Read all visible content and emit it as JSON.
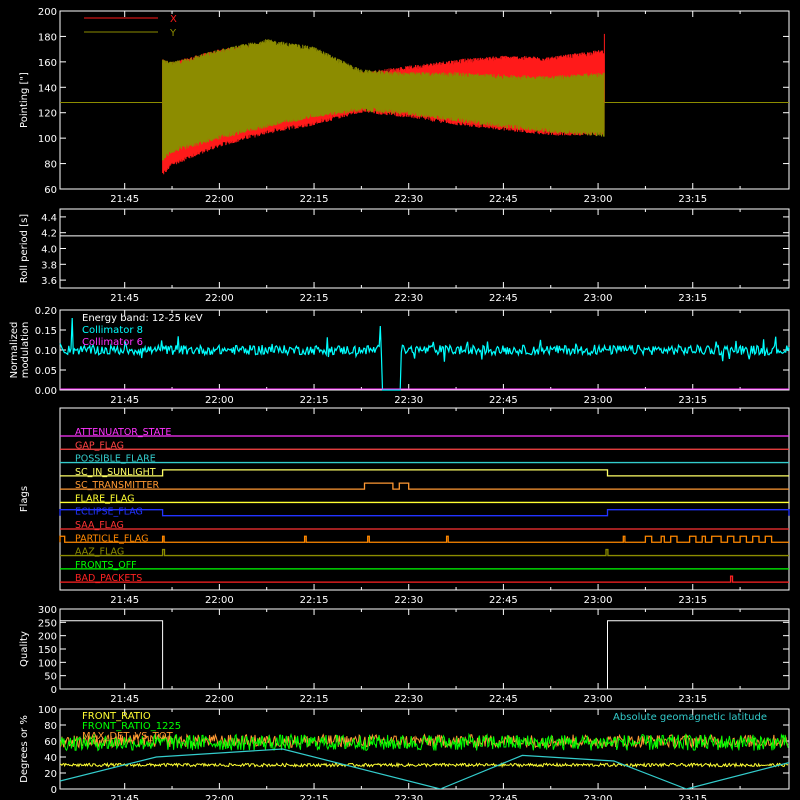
{
  "colors": {
    "background": "#000000",
    "axis": "#ffffff",
    "x_series": "#ff1a1a",
    "y_series": "#8c8c00",
    "collimator_8": "#00ffff",
    "collimator_6": "#ff33ff",
    "front_ratio": "#ffff33",
    "front_ratio_1225": "#00ff00",
    "max_det": "#ff9933",
    "geomag": "#33cccc"
  },
  "time_axis": {
    "range_minutes": [
      -20.5,
      210.5
    ],
    "tick_minutes": [
      0,
      15,
      30,
      45,
      60,
      75,
      90,
      105,
      120,
      135,
      150,
      165,
      180,
      195
    ],
    "tick_labels": [
      "21:45",
      "22:00",
      "22:15",
      "22:30",
      "22:45",
      "23:00",
      "23:15"
    ]
  },
  "chart_data": [
    {
      "id": "pointing",
      "type": "line",
      "ylabel": "Pointing [\"]",
      "ylim": [
        60,
        200
      ],
      "yticks": [
        60,
        80,
        100,
        120,
        140,
        160,
        180,
        200
      ],
      "grid": false,
      "legend": "top-left",
      "reference_line": 128,
      "series": [
        {
          "name": "X",
          "color": "#ff1a1a",
          "x_minutes": [
            12,
            15,
            30,
            45,
            60,
            75,
            90,
            105,
            120,
            135,
            152
          ],
          "low": [
            72,
            80,
            95,
            105,
            112,
            122,
            118,
            112,
            108,
            104,
            104
          ],
          "high": [
            160,
            158,
            168,
            173,
            162,
            150,
            155,
            160,
            163,
            162,
            168
          ]
        },
        {
          "name": "Y",
          "color": "#8c8c00",
          "x_minutes": [
            12,
            15,
            30,
            45,
            60,
            75,
            90,
            105,
            120,
            135,
            152
          ],
          "low": [
            84,
            90,
            101,
            110,
            118,
            123,
            120,
            115,
            110,
            106,
            103
          ],
          "high": [
            160,
            158,
            168,
            176,
            170,
            152,
            150,
            150,
            148,
            147,
            150
          ]
        }
      ]
    },
    {
      "id": "roll",
      "type": "line",
      "ylabel": "Roll period [s]",
      "ylim": [
        3.5,
        4.5
      ],
      "yticks": [
        3.6,
        3.8,
        4.0,
        4.2,
        4.4
      ],
      "tick_labels": [
        "3.6",
        "3.8",
        "4.0",
        "4.2",
        "4.4"
      ],
      "series": [
        {
          "name": "",
          "x_minutes": [
            -20.5,
            210.5
          ],
          "values": [
            4.16,
            4.16
          ]
        }
      ]
    },
    {
      "id": "modulation",
      "type": "line",
      "ylabel": "Normalized modulation",
      "ylim": [
        0,
        0.2
      ],
      "yticks": [
        0,
        0.05,
        0.1,
        0.15,
        0.2
      ],
      "tick_labels": [
        "0.00",
        "0.05",
        "0.10",
        "0.15",
        "0.20"
      ],
      "annotation": "Energy band: 12-25 keV",
      "series": [
        {
          "name": "Collimator 8",
          "baseline": 0.1,
          "scatter": 0.012,
          "gap_minutes": [
            81.5,
            87.5
          ],
          "spikes": [
            {
              "x": -16.5,
              "y": 0.18
            },
            {
              "x": 81,
              "y": 0.16
            }
          ]
        },
        {
          "name": "Collimator 6",
          "values_const": 0.0
        }
      ]
    },
    {
      "id": "flags",
      "type": "table",
      "ylabel": "Flags",
      "rows": [
        {
          "label": "ATTENUATOR_STATE",
          "color": "#ff33ff",
          "segments": []
        },
        {
          "label": "GAP_FLAG",
          "color": "#ff4444",
          "segments": []
        },
        {
          "label": "POSSIBLE_FLARE",
          "color": "#33cccc",
          "segments": []
        },
        {
          "label": "SC_IN_SUNLIGHT",
          "color": "#ffff66",
          "segments": [
            [
              12,
              153
            ]
          ]
        },
        {
          "label": "SC_TRANSMITTER",
          "color": "#ff9933",
          "segments": [
            [
              76,
              85
            ],
            [
              87,
              90
            ]
          ]
        },
        {
          "label": "FLARE_FLAG",
          "color": "#ffff33",
          "segments": []
        },
        {
          "label": "ECLIPSE_FLAG",
          "color": "#2233ff",
          "segments": [
            [
              -20.5,
              12
            ],
            [
              153,
              210.5
            ]
          ],
          "inverted": true
        },
        {
          "label": "SAA_FLAG",
          "color": "#ff3333",
          "segments": []
        },
        {
          "label": "PARTICLE_FLAG",
          "color": "#ff8800",
          "segments": [
            [
              -20.5,
              -19
            ],
            [
              12,
              12.5
            ],
            [
              57,
              57.5
            ],
            [
              77,
              77.5
            ],
            [
              102,
              102.5
            ],
            [
              158,
              158.5
            ],
            [
              165,
              167
            ],
            [
              170,
              171
            ],
            [
              173,
              175
            ],
            [
              179,
              181
            ],
            [
              183,
              184
            ],
            [
              186,
              189
            ],
            [
              191,
              193
            ],
            [
              195,
              197
            ],
            [
              199,
              201
            ],
            [
              203,
              205
            ]
          ]
        },
        {
          "label": "AAZ_FLAG",
          "color": "#8c8c00",
          "segments": [
            [
              12,
              12.6
            ],
            [
              152.5,
              153.1
            ]
          ]
        },
        {
          "label": "FRONTS_OFF",
          "color": "#00ff00",
          "segments": []
        },
        {
          "label": "BAD_PACKETS",
          "color": "#ff2222",
          "segments": [
            [
              192,
              192.6
            ]
          ]
        }
      ]
    },
    {
      "id": "quality",
      "type": "line",
      "ylabel": "Quality",
      "ylim": [
        0,
        300
      ],
      "yticks": [
        0,
        50,
        100,
        150,
        200,
        250,
        300
      ],
      "series": [
        {
          "name": "",
          "x_minutes": [
            -20.5,
            12,
            12,
            153,
            153,
            210.5
          ],
          "values": [
            256,
            256,
            0,
            0,
            256,
            256
          ]
        }
      ]
    },
    {
      "id": "ratios",
      "type": "line",
      "ylabel": "Degrees or %",
      "ylim": [
        0,
        100
      ],
      "yticks": [
        0,
        20,
        40,
        60,
        80,
        100
      ],
      "legend": "top-left",
      "series": [
        {
          "name": "FRONT_RATIO",
          "color": "#ffff33",
          "baseline": 30,
          "scatter": 2
        },
        {
          "name": "FRONT_RATIO_1225",
          "color": "#00ff00",
          "baseline": 58,
          "scatter": 10
        },
        {
          "name": "MAX_DET_VS_TOT",
          "color": "#ff9933",
          "baseline": 60,
          "scatter": 8
        },
        {
          "name": "Absolute geomagnetic latitude",
          "color": "#33cccc",
          "x_minutes": [
            -20.5,
            10,
            50,
            100,
            126,
            155,
            178,
            210.5
          ],
          "values": [
            10,
            40,
            50,
            0,
            42,
            35,
            0,
            33
          ]
        }
      ]
    }
  ]
}
